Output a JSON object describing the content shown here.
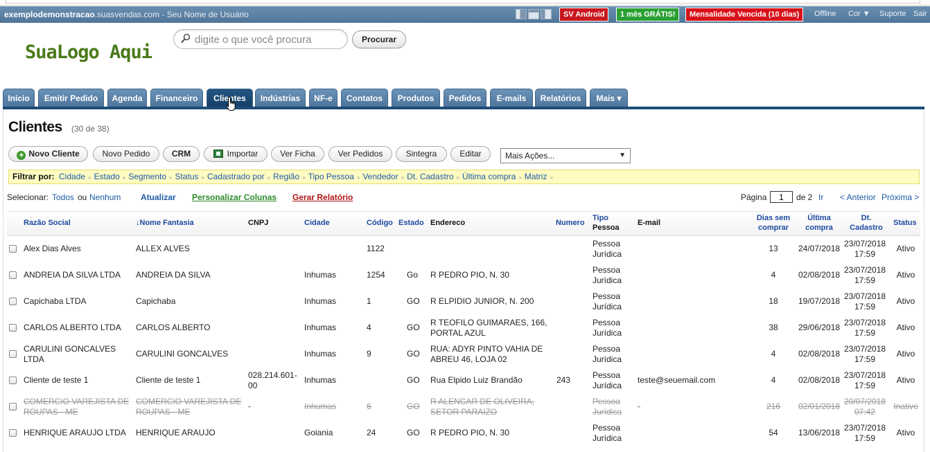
{
  "topbar": {
    "site_bold": "exemplodemonstracao",
    "site_rest": ".suasvendas.com - Seu Nome de Usuário",
    "badge_android": "SV Android",
    "badge_gratis": "1 mês GRÁTIS!",
    "badge_vencida": "Mensalidade Vencida (10 dias)",
    "offline": "Offline",
    "cor": "Cor ▼",
    "suporte": "Suporte",
    "sair": "Sair"
  },
  "header": {
    "logo": "SuaLogo Aqui",
    "search_placeholder": "digite o que você procura",
    "search_button": "Procurar"
  },
  "tabs": [
    "Início",
    "Emitir Pedido",
    "Agenda",
    "Financeiro",
    "Clientes",
    "Indústrias",
    "NF-e",
    "Contatos",
    "Produtos",
    "Pedidos",
    "E-mails",
    "Relatórios",
    "Mais ▾"
  ],
  "page": {
    "title": "Clientes",
    "count": "(30 de 38)"
  },
  "toolbar": {
    "novo_cliente": "Novo Cliente",
    "novo_pedido": "Novo Pedido",
    "crm": "CRM",
    "importar": "Importar",
    "ver_ficha": "Ver Ficha",
    "ver_pedidos": "Ver Pedidos",
    "sintegra": "Sintegra",
    "editar": "Editar",
    "mais_acoes": "Mais Ações..."
  },
  "filters": {
    "label": "Filtrar por:",
    "items": [
      "Cidade",
      "Estado",
      "Segmento",
      "Status",
      "Cadastrado por",
      "Região",
      "Tipo Pessoa",
      "Vendedor",
      "Dt. Cadastro",
      "Última compra",
      "Matriz"
    ]
  },
  "selection": {
    "label": "Selecionar:",
    "todos": "Todos",
    "ou": "ou",
    "nenhum": "Nenhum",
    "atualizar": "Atualizar",
    "personalizar": "Personalizar Colunas",
    "relatorio": "Gerar Relatório"
  },
  "pagination": {
    "pagina": "Página",
    "current": "1",
    "de": "de 2",
    "ir": "Ir",
    "anterior": "< Anterior",
    "proxima": "Próxima >"
  },
  "columns": {
    "razao": "Razão Social",
    "fantasia": "↓Nome Fantasia",
    "cnpj": "CNPJ",
    "cidade": "Cidade",
    "codigo": "Código",
    "estado": "Estado",
    "endereco": "Endereco",
    "numero": "Numero",
    "tipo_1": "Tipo",
    "tipo_2": "Pessoa",
    "email": "E-mail",
    "dias_1": "Dias sem",
    "dias_2": "comprar",
    "ultima_1": "Última",
    "ultima_2": "compra",
    "dt_1": "Dt.",
    "dt_2": "Cadastro",
    "status": "Status"
  },
  "rows": [
    {
      "razao_1": "Alex Dias Alves",
      "razao_2": "",
      "fantasia_1": "ALLEX ALVES",
      "fantasia_2": "",
      "cnpj_1": "",
      "cnpj_2": "",
      "cidade": "",
      "codigo": "1122",
      "estado": "",
      "end_1": "",
      "end_2": "",
      "numero": "",
      "tipo_1": "Pessoa",
      "tipo_2": "Jurídica",
      "email": "",
      "dias": "13",
      "ultima": "24/07/2018",
      "cad_1": "23/07/2018",
      "cad_2": "17:59",
      "status": "Ativo",
      "deleted": false
    },
    {
      "razao_1": "ANDREIA DA SILVA LTDA",
      "razao_2": "",
      "fantasia_1": "ANDREIA DA SILVA",
      "fantasia_2": "",
      "cnpj_1": "",
      "cnpj_2": "",
      "cidade": "Inhumas",
      "codigo": "1254",
      "estado": "Go",
      "end_1": "R PEDRO PIO, N. 30",
      "end_2": "",
      "numero": "",
      "tipo_1": "Pessoa",
      "tipo_2": "Jurídica",
      "email": "",
      "dias": "4",
      "ultima": "02/08/2018",
      "cad_1": "23/07/2018",
      "cad_2": "17:59",
      "status": "Ativo",
      "deleted": false
    },
    {
      "razao_1": "Capichaba LTDA",
      "razao_2": "",
      "fantasia_1": "Capichaba",
      "fantasia_2": "",
      "cnpj_1": "",
      "cnpj_2": "",
      "cidade": "Inhumas",
      "codigo": "1",
      "estado": "GO",
      "end_1": "R ELPIDIO JUNIOR, N. 200",
      "end_2": "",
      "numero": "",
      "tipo_1": "Pessoa",
      "tipo_2": "Jurídica",
      "email": "",
      "dias": "18",
      "ultima": "19/07/2018",
      "cad_1": "23/07/2018",
      "cad_2": "17:59",
      "status": "Ativo",
      "deleted": false
    },
    {
      "razao_1": "CARLOS ALBERTO LTDA",
      "razao_2": "",
      "fantasia_1": "CARLOS ALBERTO",
      "fantasia_2": "",
      "cnpj_1": "",
      "cnpj_2": "",
      "cidade": "Inhumas",
      "codigo": "4",
      "estado": "GO",
      "end_1": "R TEOFILO GUIMARAES, 166,",
      "end_2": "PORTAL AZUL",
      "numero": "",
      "tipo_1": "Pessoa",
      "tipo_2": "Jurídica",
      "email": "",
      "dias": "38",
      "ultima": "29/06/2018",
      "cad_1": "23/07/2018",
      "cad_2": "17:59",
      "status": "Ativo",
      "deleted": false
    },
    {
      "razao_1": "CARULINI GONCALVES",
      "razao_2": "LTDA",
      "fantasia_1": "CARULINI GONCALVES",
      "fantasia_2": "",
      "cnpj_1": "",
      "cnpj_2": "",
      "cidade": "Inhumas",
      "codigo": "9",
      "estado": "GO",
      "end_1": "RUA: ADYR PINTO VAHIA DE",
      "end_2": "ABREU 46, LOJA 02",
      "numero": "",
      "tipo_1": "Pessoa",
      "tipo_2": "Jurídica",
      "email": "",
      "dias": "4",
      "ultima": "02/08/2018",
      "cad_1": "23/07/2018",
      "cad_2": "17:59",
      "status": "Ativo",
      "deleted": false
    },
    {
      "razao_1": "Cliente de teste 1",
      "razao_2": "",
      "fantasia_1": "Cliente de teste 1",
      "fantasia_2": "",
      "cnpj_1": "028.214.601-",
      "cnpj_2": "00",
      "cidade": "Inhumas",
      "codigo": "",
      "estado": "GO",
      "end_1": "Rua Elpido Luiz Brandão",
      "end_2": "",
      "numero": "243",
      "tipo_1": "Pessoa",
      "tipo_2": "Jurídica",
      "email": "teste@seuemail.com",
      "dias": "4",
      "ultima": "02/08/2018",
      "cad_1": "23/07/2018",
      "cad_2": "17:59",
      "status": "Ativo",
      "deleted": false
    },
    {
      "razao_1": "COMERCIO VAREJISTA DE",
      "razao_2": "ROUPAS - ME",
      "fantasia_1": "COMERCIO VAREJISTA DE",
      "fantasia_2": "ROUPAS - ME",
      "cnpj_1": "-",
      "cnpj_2": "",
      "cidade": "Inhumas",
      "codigo": "6",
      "estado": "GO",
      "end_1": "R ALENCAR DE OLIVEIRA,",
      "end_2": "SETOR PARAIZO",
      "numero": "",
      "tipo_1": "Pessoa",
      "tipo_2": "Jurídica",
      "email": "-",
      "dias": "216",
      "ultima": "02/01/2018",
      "cad_1": "20/07/2018",
      "cad_2": "07:42",
      "status": "Inativo",
      "deleted": true
    },
    {
      "razao_1": "HENRIQUE ARAUJO LTDA",
      "razao_2": "",
      "fantasia_1": "HENRIQUE ARAUJO",
      "fantasia_2": "",
      "cnpj_1": "",
      "cnpj_2": "",
      "cidade": "Goiania",
      "codigo": "24",
      "estado": "GO",
      "end_1": "R PEDRO PIO, N. 30",
      "end_2": "",
      "numero": "",
      "tipo_1": "Pessoa",
      "tipo_2": "Jurídica",
      "email": "",
      "dias": "54",
      "ultima": "13/06/2018",
      "cad_1": "23/07/2018",
      "cad_2": "17:59",
      "status": "Ativo",
      "deleted": false
    }
  ]
}
